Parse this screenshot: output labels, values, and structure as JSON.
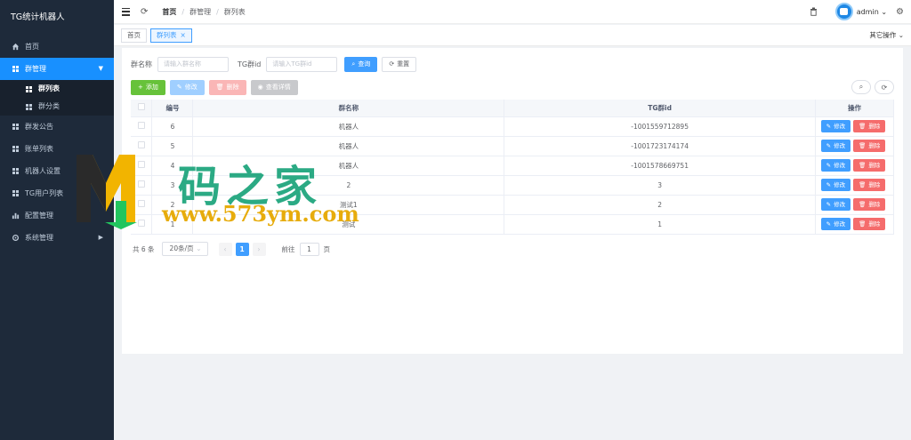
{
  "app": {
    "title": "TG统计机器人"
  },
  "sidebar": {
    "items": [
      {
        "label": "首页",
        "icon": "home-icon"
      },
      {
        "label": "群管理",
        "icon": "grid-icon",
        "active": true,
        "children": [
          {
            "label": "群列表",
            "selected": true
          },
          {
            "label": "群分类"
          }
        ]
      },
      {
        "label": "群发公告",
        "icon": "grid-icon"
      },
      {
        "label": "账单列表",
        "icon": "grid-icon"
      },
      {
        "label": "机器人设置",
        "icon": "grid-icon"
      },
      {
        "label": "TG用户列表",
        "icon": "grid-icon"
      },
      {
        "label": "配置管理",
        "icon": "chart-icon"
      },
      {
        "label": "系统管理",
        "icon": "gear-icon"
      }
    ]
  },
  "header": {
    "breadcrumb": [
      "首页",
      "群管理",
      "群列表"
    ],
    "user": "admin"
  },
  "tags": {
    "items": [
      {
        "label": "首页"
      },
      {
        "label": "群列表",
        "active": true
      }
    ],
    "close": "×",
    "other_ops": "其它操作"
  },
  "search": {
    "name_label": "群名称",
    "name_placeholder": "请输入群名称",
    "tgid_label": "TG群id",
    "tgid_placeholder": "请输入TG群id",
    "query": "查询",
    "reset": "重置"
  },
  "toolbar": {
    "add": "添加",
    "edit": "修改",
    "delete": "删除",
    "view": "查看详情"
  },
  "table": {
    "headers": [
      "编号",
      "群名称",
      "TG群id",
      "操作"
    ],
    "rows": [
      {
        "id": "6",
        "name": "机器人",
        "tgid": "-1001559712895"
      },
      {
        "id": "5",
        "name": "机器人",
        "tgid": "-1001723174174"
      },
      {
        "id": "4",
        "name": "机器人",
        "tgid": "-1001578669751"
      },
      {
        "id": "3",
        "name": "2",
        "tgid": "3"
      },
      {
        "id": "2",
        "name": "测试1",
        "tgid": "2"
      },
      {
        "id": "1",
        "name": "测试",
        "tgid": "1"
      }
    ],
    "row_edit": "修改",
    "row_delete": "删除"
  },
  "pagination": {
    "total": "共 6 条",
    "page_size": "20条/页",
    "current": "1",
    "goto_label": "前往",
    "goto_value": "1",
    "page_suffix": "页"
  },
  "watermark": {
    "title": "码之家",
    "url": "www.573ym.com"
  },
  "colors": {
    "sidebar": "#1e2a3a",
    "primary": "#409eff",
    "success": "#67c23a",
    "danger": "#f56c6c"
  }
}
